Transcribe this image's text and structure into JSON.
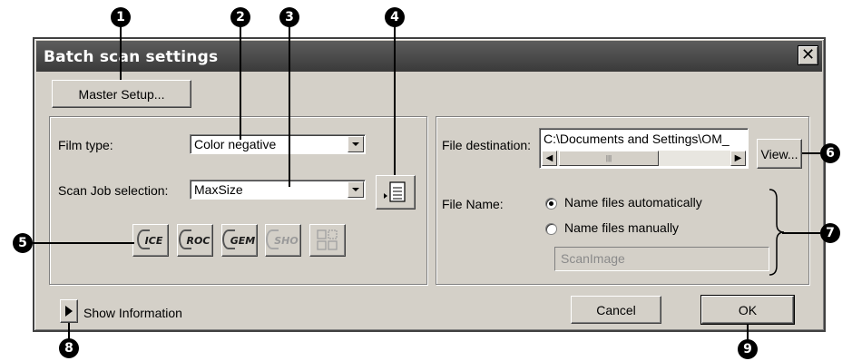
{
  "window": {
    "title": "Batch scan settings",
    "close_glyph": "✕"
  },
  "master_setup_label": "Master Setup...",
  "left_panel": {
    "film_type_label": "Film type:",
    "film_type_value": "Color negative",
    "scan_job_label": "Scan Job selection:",
    "scan_job_value": "MaxSize",
    "effect_buttons": [
      {
        "label": "ICE",
        "state": "enabled"
      },
      {
        "label": "ROC",
        "state": "enabled"
      },
      {
        "label": "GEM",
        "state": "enabled"
      },
      {
        "label": "SHO",
        "state": "disabled"
      },
      {
        "label": "",
        "state": "disabled",
        "icon": "grid-icon"
      }
    ]
  },
  "right_panel": {
    "file_destination_label": "File destination:",
    "file_destination_value": "C:\\Documents and Settings\\OM_",
    "scroll_thumb_glyph": "|||",
    "view_label": "View...",
    "file_name_label": "File Name:",
    "radio_auto_label": "Name files automatically",
    "radio_manual_label": "Name files manually",
    "name_field_value": "ScanImage"
  },
  "show_information_label": "Show Information",
  "cancel_label": "Cancel",
  "ok_label": "OK",
  "callouts": [
    "1",
    "2",
    "3",
    "4",
    "5",
    "6",
    "7",
    "8",
    "9"
  ]
}
